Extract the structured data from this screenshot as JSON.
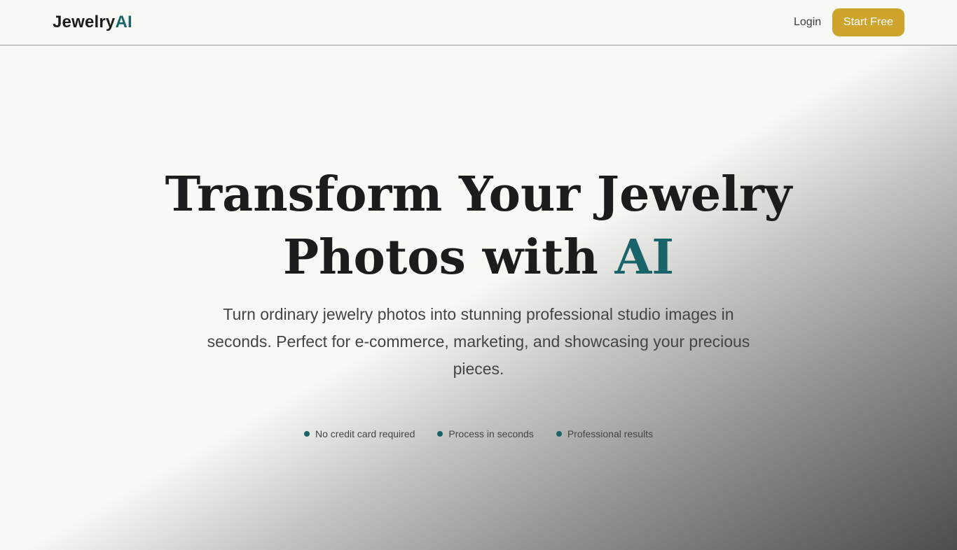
{
  "header": {
    "logo_main": "Jewelry",
    "logo_accent": "AI",
    "login_label": "Login",
    "start_label": "Start Free"
  },
  "hero": {
    "title_part1": "Transform Your Jewelry",
    "title_part2": "Photos with ",
    "title_accent": "AI",
    "subtitle": "Turn ordinary jewelry photos into stunning professional studio images in seconds. Perfect for e-commerce, marketing, and showcasing your precious pieces.",
    "features": [
      {
        "label": "No credit card required",
        "icon": "dot-icon"
      },
      {
        "label": "Process in seconds",
        "icon": "dot-icon"
      },
      {
        "label": "Professional results",
        "icon": "dot-icon"
      }
    ]
  },
  "colors": {
    "accent": "#19636a",
    "button": "#cfa42d",
    "background": "#f8f8f4",
    "text": "#1c1c1c"
  }
}
